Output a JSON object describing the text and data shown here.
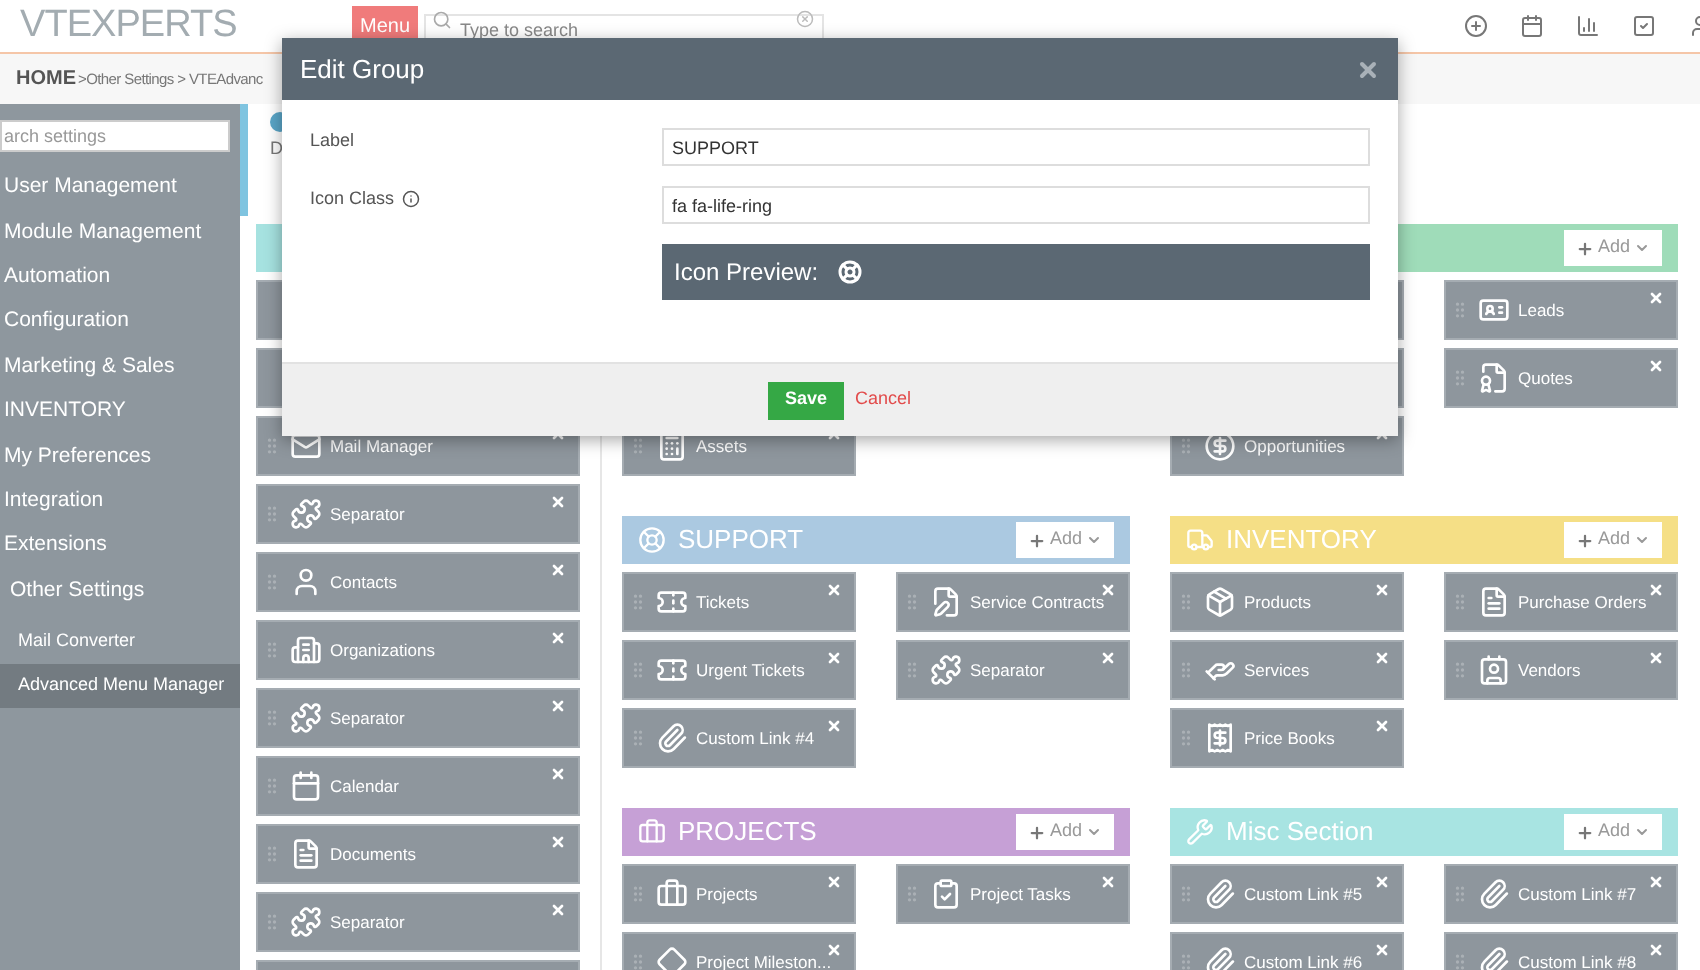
{
  "header": {
    "logo": "VTEXPERTS",
    "menu_button": "Menu",
    "search": {
      "placeholder": "Type to search"
    }
  },
  "breadcrumb": {
    "home": "HOME",
    "path": ">Other Settings > VTEAdvanc"
  },
  "sidebar": {
    "search": {
      "placeholder": "arch settings"
    },
    "items": [
      {
        "label": "User Management",
        "selected": false
      },
      {
        "label": "Module Management",
        "selected": false
      },
      {
        "label": "Automation",
        "selected": false
      },
      {
        "label": "Configuration",
        "selected": false
      },
      {
        "label": "Marketing & Sales",
        "selected": false
      },
      {
        "label": "INVENTORY",
        "selected": false
      },
      {
        "label": "My Preferences",
        "selected": false
      },
      {
        "label": "Integration",
        "selected": false
      },
      {
        "label": "Extensions",
        "selected": false
      },
      {
        "label": "Other Settings",
        "selected": false,
        "children": [
          {
            "label": "Mail Converter",
            "selected": false
          },
          {
            "label": "Advanced Menu Manager",
            "selected": true
          }
        ]
      }
    ]
  },
  "page_description": "D",
  "columns": [
    {
      "kind": "single",
      "sections": [
        {
          "color": "#a6e2e0",
          "items": [
            {
              "kind": "covered"
            },
            {
              "kind": "covered"
            },
            {
              "kind": "link",
              "label": "Mail Manager"
            },
            {
              "kind": "link",
              "label": "Separator"
            },
            {
              "kind": "link",
              "label": "Contacts"
            },
            {
              "kind": "link",
              "label": "Organizations"
            },
            {
              "kind": "link",
              "label": "Separator"
            },
            {
              "kind": "link",
              "label": "Calendar"
            },
            {
              "kind": "link",
              "label": "Documents"
            },
            {
              "kind": "link",
              "label": "Separator"
            },
            {
              "kind": "covered"
            }
          ]
        }
      ]
    },
    {
      "kind": "double",
      "sections": [
        {
          "kind": "covered",
          "items": [
            {
              "kind": "link",
              "label": "Assets"
            }
          ]
        },
        {
          "title": "SUPPORT",
          "color": "#abc9e1",
          "add_button": "Add",
          "items": [
            {
              "kind": "link",
              "label": "Tickets"
            },
            {
              "kind": "link",
              "label": "Service Contracts"
            },
            {
              "kind": "link",
              "label": "Urgent Tickets"
            },
            {
              "kind": "link",
              "label": "Separator"
            },
            {
              "kind": "link",
              "label": "Custom Link #4"
            }
          ]
        },
        {
          "title": "PROJECTS",
          "color": "#c6a0d6",
          "add_button": "Add",
          "items": [
            {
              "kind": "link",
              "label": "Projects"
            },
            {
              "kind": "link",
              "label": "Project Tasks"
            },
            {
              "kind": "link",
              "label": "Project Mileston..."
            }
          ]
        }
      ]
    },
    {
      "kind": "double",
      "sections": [
        {
          "color": "#9fdcb9",
          "add_button": "Add",
          "items": [
            {
              "kind": "covered"
            },
            {
              "kind": "link",
              "label": "Leads"
            },
            {
              "kind": "covered"
            },
            {
              "kind": "link",
              "label": "Quotes"
            },
            {
              "kind": "link",
              "label": "Opportunities"
            }
          ]
        },
        {
          "title": "INVENTORY",
          "color": "#f5df86",
          "add_button": "Add",
          "items": [
            {
              "kind": "link",
              "label": "Products"
            },
            {
              "kind": "link",
              "label": "Purchase Orders"
            },
            {
              "kind": "link",
              "label": "Services"
            },
            {
              "kind": "link",
              "label": "Vendors"
            },
            {
              "kind": "link",
              "label": "Price Books"
            }
          ]
        },
        {
          "title": "Misc Section",
          "color": "#a8e4e2",
          "add_button": "Add",
          "items": [
            {
              "kind": "link",
              "label": "Custom Link #5"
            },
            {
              "kind": "link",
              "label": "Custom Link #7"
            },
            {
              "kind": "link",
              "label": "Custom Link #6"
            },
            {
              "kind": "link",
              "label": "Custom Link #8"
            }
          ]
        }
      ]
    }
  ],
  "modal": {
    "title": "Edit Group",
    "fields": [
      {
        "label": "Label",
        "value": "SUPPORT",
        "info": false
      },
      {
        "label": "Icon Class",
        "value": "fa fa-life-ring",
        "info": true
      }
    ],
    "preview_label": "Icon Preview:",
    "buttons": [
      {
        "kind": "primary",
        "label": "Save"
      },
      {
        "kind": "link",
        "label": "Cancel"
      }
    ]
  }
}
